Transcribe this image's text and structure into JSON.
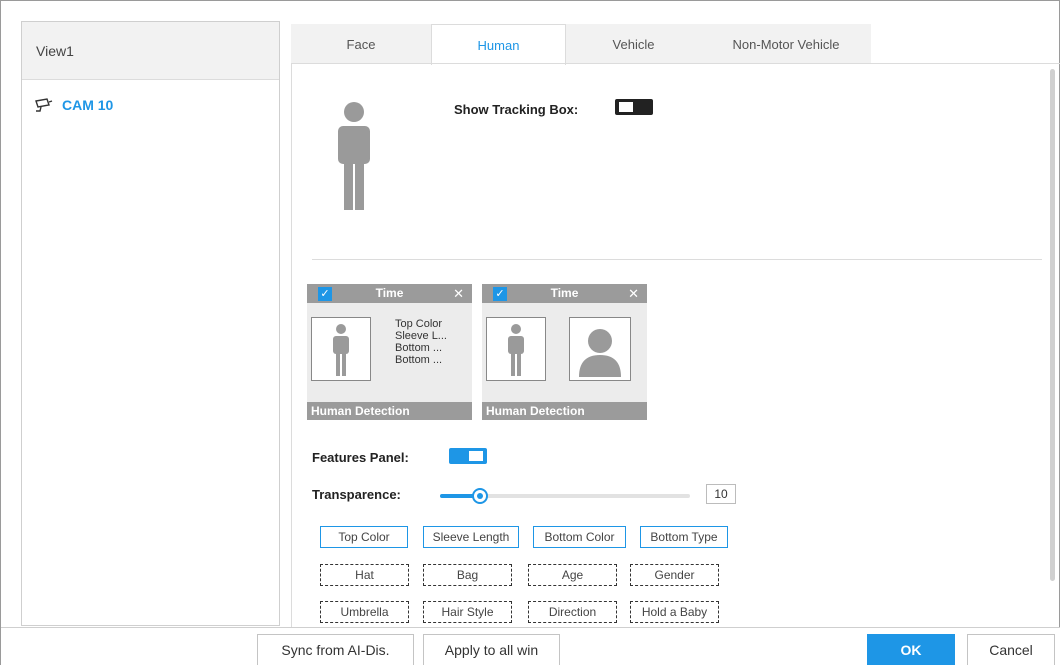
{
  "left_panel": {
    "view_title": "View1",
    "camera": {
      "icon": "camera-icon",
      "label": "CAM 10"
    }
  },
  "tabs": [
    {
      "label": "Face",
      "active": false
    },
    {
      "label": "Human",
      "active": true
    },
    {
      "label": "Vehicle",
      "active": false
    },
    {
      "label": "Non-Motor Vehicle",
      "active": false
    }
  ],
  "tracking": {
    "label": "Show Tracking Box:",
    "enabled": false
  },
  "preview_cards": [
    {
      "checked": true,
      "title": "Time",
      "footer": "Human Detection",
      "lines": [
        "Top Color",
        "Sleeve L...",
        "Bottom ...",
        "Bottom ..."
      ]
    },
    {
      "checked": true,
      "title": "Time",
      "footer": "Human Detection",
      "lines": []
    }
  ],
  "features_panel": {
    "label": "Features Panel:",
    "enabled": true
  },
  "transparence": {
    "label": "Transparence:",
    "value": "10",
    "level_percent": 10
  },
  "features": [
    {
      "label": "Top Color",
      "selected": true
    },
    {
      "label": "Sleeve Length",
      "selected": true
    },
    {
      "label": "Bottom Color",
      "selected": true
    },
    {
      "label": "Bottom Type",
      "selected": true
    },
    {
      "label": "Hat",
      "selected": false
    },
    {
      "label": "Bag",
      "selected": false
    },
    {
      "label": "Age",
      "selected": false
    },
    {
      "label": "Gender",
      "selected": false
    },
    {
      "label": "Umbrella",
      "selected": false
    },
    {
      "label": "Hair Style",
      "selected": false
    },
    {
      "label": "Direction",
      "selected": false
    },
    {
      "label": "Hold a Baby",
      "selected": false
    }
  ],
  "buttons": {
    "sync": "Sync from AI-Dis.",
    "apply": "Apply to all win",
    "ok": "OK",
    "cancel": "Cancel"
  },
  "colors": {
    "accent": "#1e96e6",
    "card_bar": "#9b9b9b",
    "toggle_off": "#222222"
  }
}
